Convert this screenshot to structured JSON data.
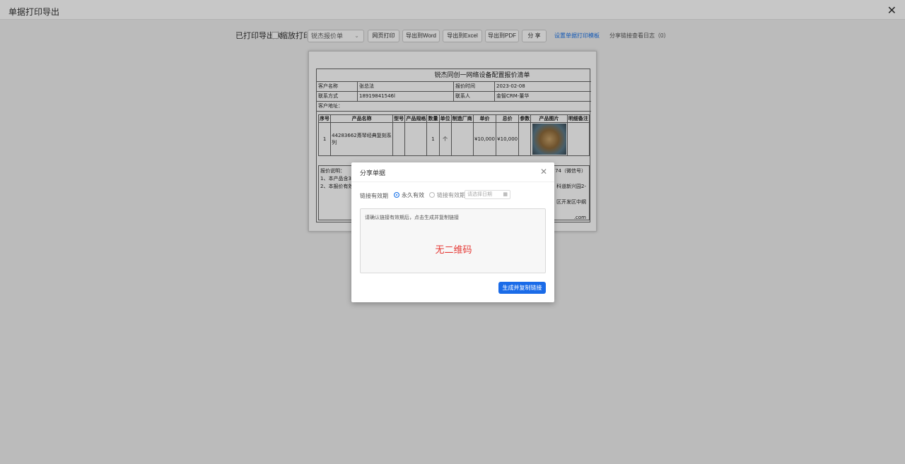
{
  "window": {
    "title": "单据打印导出"
  },
  "toolbar": {
    "printed_label": "已打印导出次",
    "zoom_print_label": "缩放打印",
    "template_select": "锐杰报价单",
    "web_print": "网页打印",
    "export_word": "导出到Word",
    "export_excel": "导出到Excel",
    "export_pdf": "导出到PDF",
    "share": "分 享",
    "set_template": "设置单据打印模板",
    "share_log": "分享链接查看日志（0）"
  },
  "document": {
    "title": "锐杰同创一网络设备配置报价清单",
    "customer_name_label": "客户名称",
    "customer_name": "张总法",
    "quote_time_label": "报价时间",
    "quote_time": "2023-02-08",
    "contact_label": "联系方式",
    "contact": "18919841546l",
    "contact_person_label": "联系人",
    "contact_person": "金智CRM-董华",
    "address_label": "客户地址：",
    "table_headers": [
      "序号",
      "产品名称",
      "型号",
      "产品规格",
      "数量",
      "单位",
      "制造厂商",
      "单价",
      "总价",
      "参数",
      "产品图片",
      "明细备注"
    ],
    "rows": [
      {
        "no": "1",
        "name": "44283662斎琴经典复刻系列",
        "model": "",
        "spec": "",
        "qty": "1",
        "unit": "个",
        "maker": "",
        "price": "¥10,000",
        "total": "¥10,000",
        "params": "",
        "remark": ""
      }
    ],
    "notes_label": "报价说明：",
    "note1": "1、本产品含3%",
    "note2": "2、本报价有效",
    "right1": "74（微信号）",
    "right2": "科道新兴园2-",
    "right3": "区开发区中纲",
    "right4": ".com"
  },
  "modal": {
    "title": "分享单据",
    "validity_label": "链接有效期",
    "option_forever": "永久有效",
    "option_period": "链接有效期",
    "date_placeholder": "请选择日期",
    "hint": "请确认链接有效期后，点击生成并复制链接",
    "qr_text": "无二维码",
    "generate_button": "生成并复制链接"
  }
}
